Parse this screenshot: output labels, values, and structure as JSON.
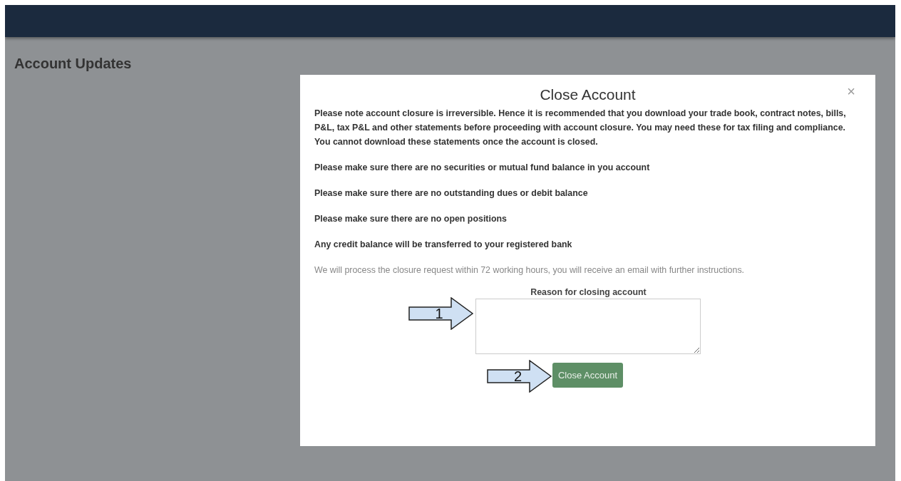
{
  "page": {
    "title": "Account Updates"
  },
  "modal": {
    "title": "Close Account",
    "close": "×",
    "notes": [
      {
        "kind": "strong",
        "text": "Please note account closure is irreversible. Hence it is recommended that you download your trade book, contract notes, bills, P&L, tax P&L and other statements before proceeding with account closure. You may need these for tax filing and compliance. You cannot download these statements once the account is closed."
      },
      {
        "kind": "strong",
        "text": "Please make sure there are no securities or mutual fund balance in you account"
      },
      {
        "kind": "strong",
        "text": "Please make sure there are no outstanding dues or debit balance"
      },
      {
        "kind": "strong",
        "text": "Please make sure there are no open positions"
      },
      {
        "kind": "strong",
        "text": "Any credit balance will be transferred to your registered bank"
      },
      {
        "kind": "muted",
        "text": "We will process the closure request within 72 working hours, you will receive an email with further instructions."
      }
    ],
    "reason_field": {
      "label": "Reason for closing account",
      "callout": "1"
    },
    "submit_button": {
      "label": "Close Account",
      "callout": "2"
    }
  }
}
